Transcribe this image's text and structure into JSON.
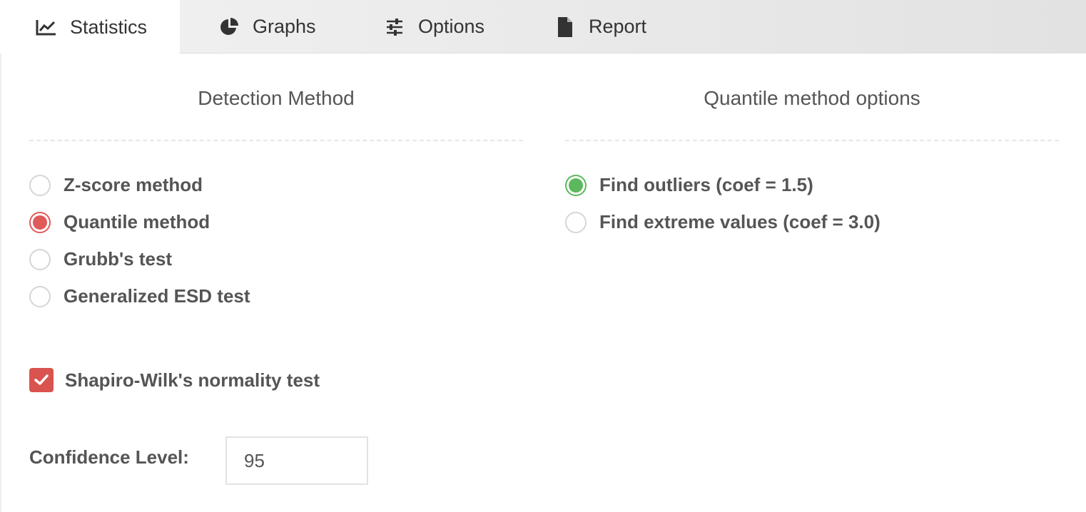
{
  "tabs": [
    {
      "label": "Statistics",
      "icon": "line-chart-icon",
      "active": true
    },
    {
      "label": "Graphs",
      "icon": "pie-chart-icon",
      "active": false
    },
    {
      "label": "Options",
      "icon": "sliders-icon",
      "active": false
    },
    {
      "label": "Report",
      "icon": "file-icon",
      "active": false
    }
  ],
  "detection": {
    "title": "Detection Method",
    "options": [
      {
        "label": "Z-score method",
        "selected": false
      },
      {
        "label": "Quantile method",
        "selected": true
      },
      {
        "label": "Grubb's test",
        "selected": false
      },
      {
        "label": "Generalized ESD test",
        "selected": false
      }
    ],
    "selected_color": "#e05a5a"
  },
  "quantile": {
    "title": "Quantile method options",
    "options": [
      {
        "label": "Find outliers (coef = 1.5)",
        "selected": true
      },
      {
        "label": "Find extreme values (coef = 3.0)",
        "selected": false
      }
    ],
    "selected_color": "#5cb85c"
  },
  "normality": {
    "label": "Shapiro-Wilk's normality test",
    "checked": true,
    "color": "#d9534f"
  },
  "confidence": {
    "label": "Confidence Level:",
    "value": "95"
  }
}
